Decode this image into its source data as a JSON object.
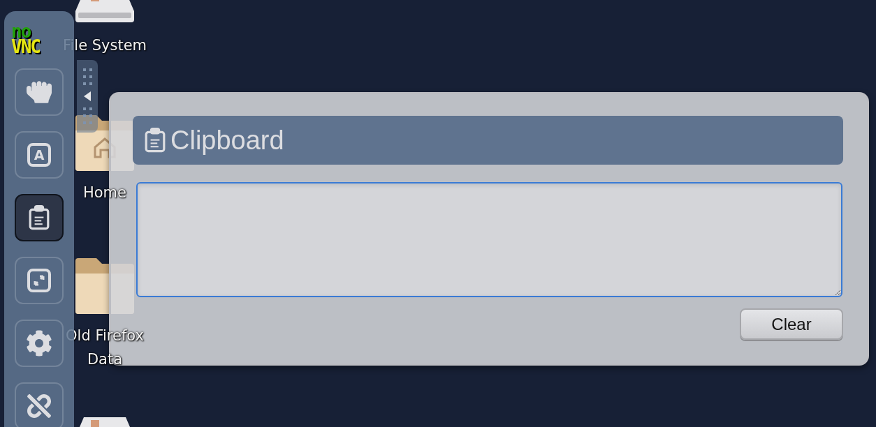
{
  "desktop_icons": [
    {
      "kind": "drive",
      "label": "File System"
    },
    {
      "kind": "home",
      "label": "Home"
    },
    {
      "kind": "folder",
      "label": "Old Firefox Data"
    },
    {
      "kind": "drive"
    }
  ],
  "control_bar": {
    "logo": {
      "line1": "no",
      "line2": "VNC"
    },
    "buttons": [
      {
        "selected": false
      },
      {
        "glyph": "A",
        "selected": false
      },
      {
        "selected": true
      },
      {
        "selected": false
      },
      {
        "selected": false
      },
      {
        "selected": false
      }
    ]
  },
  "clipboard_panel": {
    "title": "Clipboard",
    "clear_button": "Clear"
  }
}
